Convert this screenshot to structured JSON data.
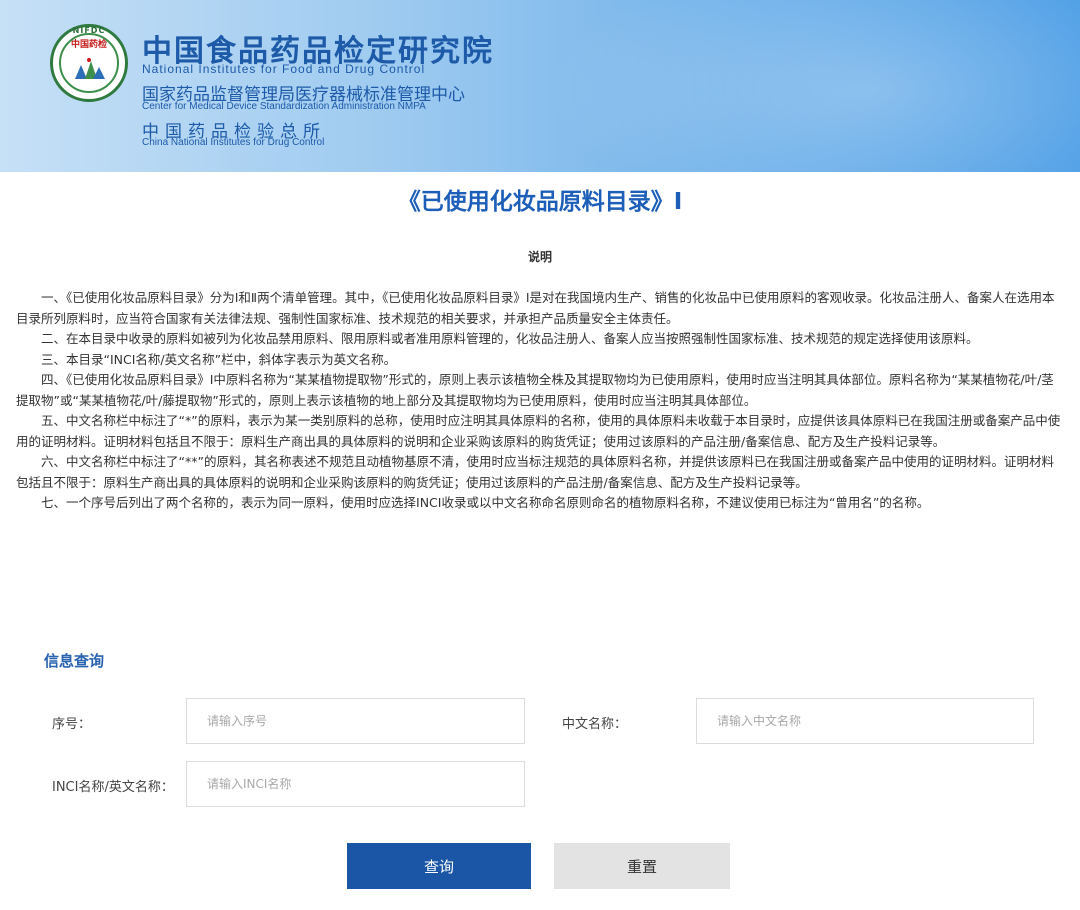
{
  "header": {
    "logo": {
      "abbr": "NIFDC",
      "text": "中国药检",
      "icon": "nifdc-emblem-icon"
    },
    "org_name_cn": "中国食品药品检定研究院",
    "org_name_en": "National Institutes for Food and Drug Control",
    "sub1_cn": "国家药品监督管理局医疗器械标准管理中心",
    "sub1_en": "Center for Medical Device Standardization Administration NMPA",
    "sub2_cn": "中国药品检验总所",
    "sub2_en": "China National Institutes for Drug Control"
  },
  "page": {
    "title": "《已使用化妆品原料目录》I",
    "section_title": "说明"
  },
  "notes": [
    "一、《已使用化妆品原料目录》分为Ⅰ和Ⅱ两个清单管理。其中，《已使用化妆品原料目录》Ⅰ是对在我国境内生产、销售的化妆品中已使用原料的客观收录。化妆品注册人、备案人在选用本目录所列原料时，应当符合国家有关法律法规、强制性国家标准、技术规范的相关要求，并承担产品质量安全主体责任。",
    "二、在本目录中收录的原料如被列为化妆品禁用原料、限用原料或者准用原料管理的，化妆品注册人、备案人应当按照强制性国家标准、技术规范的规定选择使用该原料。",
    "三、本目录“INCI名称/英文名称”栏中，斜体字表示为英文名称。",
    "四、《已使用化妆品原料目录》Ⅰ中原料名称为“某某植物提取物”形式的，原则上表示该植物全株及其提取物均为已使用原料，使用时应当注明其具体部位。原料名称为“某某植物花/叶/茎提取物”或“某某植物花/叶/藤提取物”形式的，原则上表示该植物的地上部分及其提取物均为已使用原料，使用时应当注明其具体部位。",
    "五、中文名称栏中标注了“*”的原料，表示为某一类别原料的总称，使用时应注明其具体原料的名称，使用的具体原料未收载于本目录时，应提供该具体原料已在我国注册或备案产品中使用的证明材料。证明材料包括且不限于：原料生产商出具的具体原料的说明和企业采购该原料的购货凭证；使用过该原料的产品注册/备案信息、配方及生产投料记录等。",
    "六、中文名称栏中标注了“**”的原料，其名称表述不规范且动植物基原不清，使用时应当标注规范的具体原料名称，并提供该原料已在我国注册或备案产品中使用的证明材料。证明材料包括且不限于：原料生产商出具的具体原料的说明和企业采购该原料的购货凭证；使用过该原料的产品注册/备案信息、配方及生产投料记录等。",
    "七、一个序号后列出了两个名称的，表示为同一原料，使用时应选择INCI收录或以中文名称命名原则命名的植物原料名称，不建议使用已标注为“曾用名”的名称。"
  ],
  "query": {
    "title": "信息查询",
    "serial_label": "序号：",
    "serial_placeholder": "请输入序号",
    "cn_name_label": "中文名称：",
    "cn_name_placeholder": "请输入中文名称",
    "inci_label": "INCI名称/英文名称：",
    "inci_placeholder": "请输入INCI名称",
    "search_button": "查询",
    "reset_button": "重置"
  },
  "colors": {
    "primary_blue": "#1b56a6",
    "title_blue": "#1d5fb8",
    "header_blue": "#1d5aa8"
  }
}
